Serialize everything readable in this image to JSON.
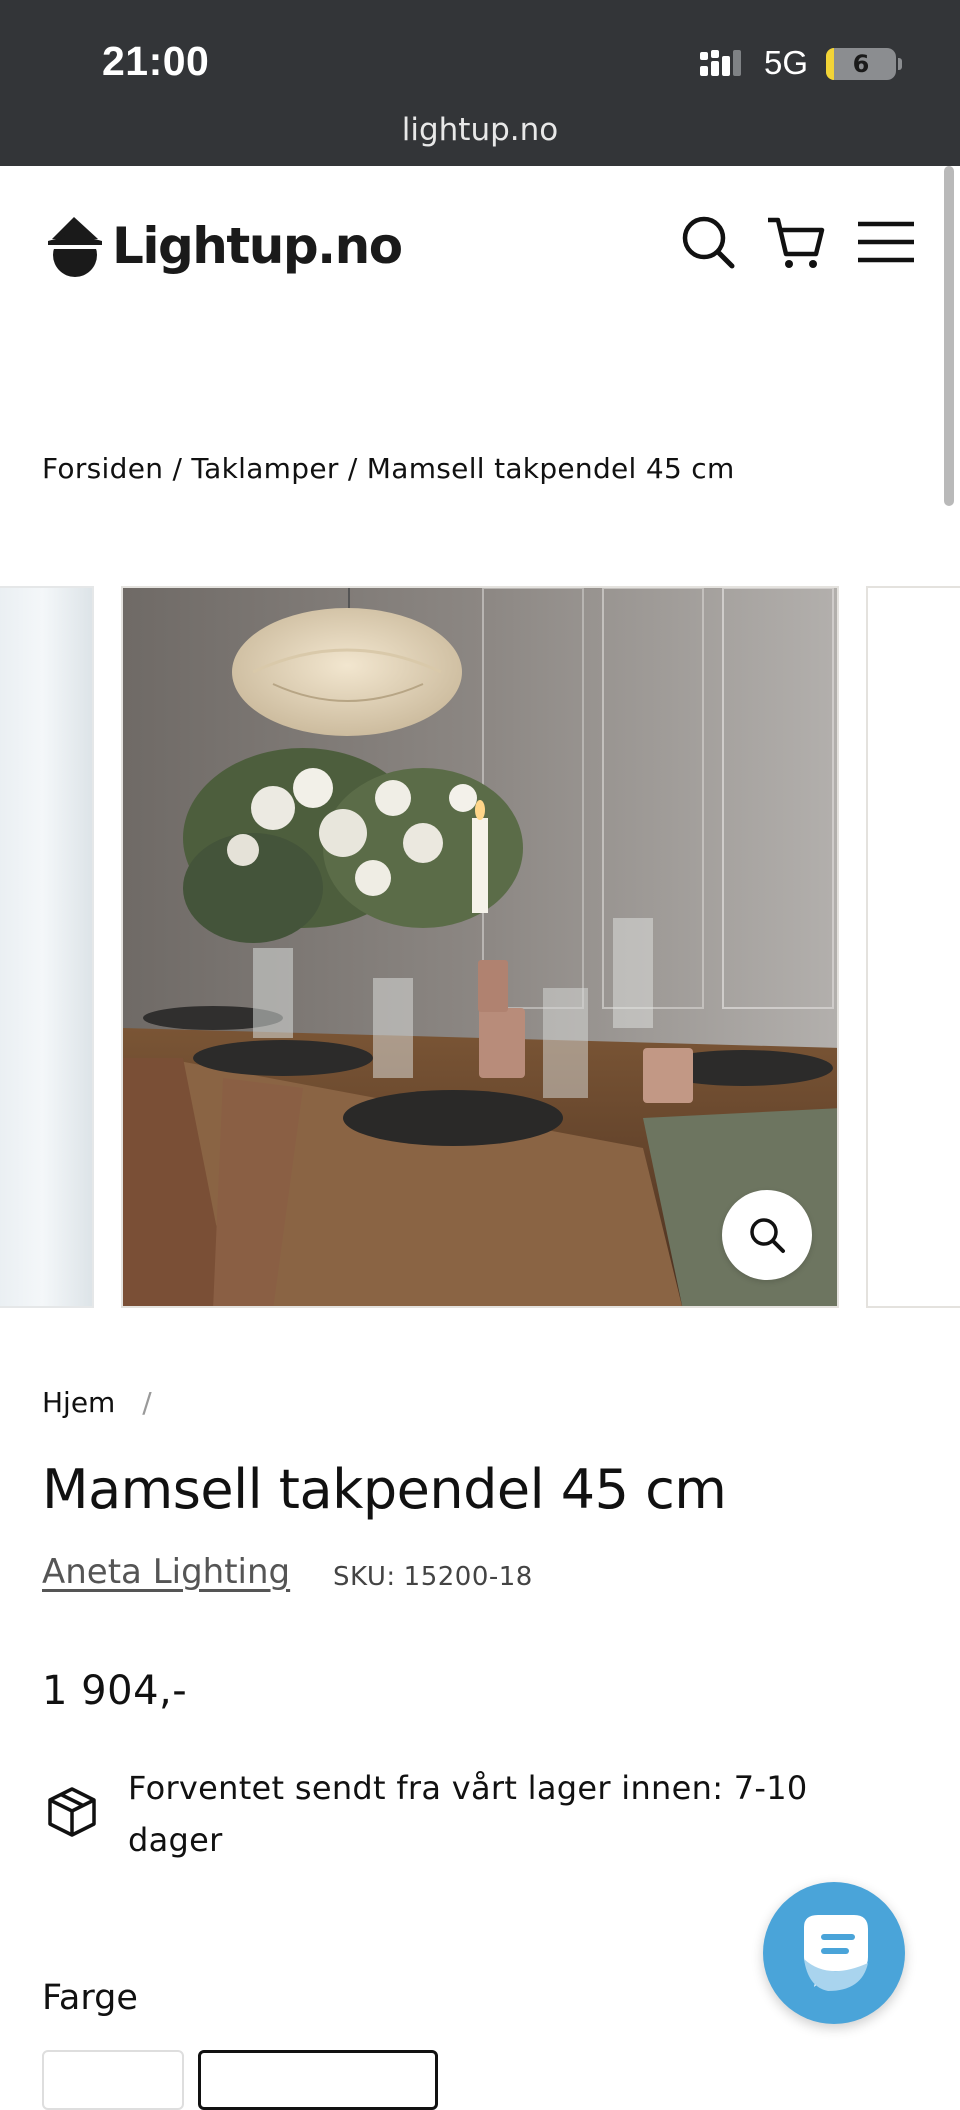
{
  "status_bar": {
    "time": "21:00",
    "network": "5G",
    "battery_level": "6",
    "battery_fraction": 0.06,
    "url": "lightup.no"
  },
  "header": {
    "logo_text": "Lightup.no",
    "icons": [
      "search-icon",
      "cart-icon",
      "menu-icon"
    ]
  },
  "breadcrumb": {
    "text": "Forsiden / Taklamper / Mamsell takpendel 45 cm"
  },
  "gallery": {
    "zoom_icon": "search-icon",
    "main_image_subject": "pendant-lamp-over-dining-table"
  },
  "product": {
    "crumb_home": "Hjem",
    "crumb_sep": "/",
    "title": "Mamsell takpendel 45 cm",
    "brand": "Aneta Lighting",
    "sku_label": "SKU:",
    "sku_value": "15200-18",
    "price": "1 904,-",
    "shipping_icon": "package-icon",
    "shipping_text": "Forventet sendt fra vårt lager innen: 7-10 dager",
    "color_label": "Farge"
  },
  "chat": {
    "icon": "chat-icon"
  },
  "colors": {
    "status_bar_bg": "#333538",
    "chat_button": "#4aa4d9",
    "text": "#111111"
  }
}
